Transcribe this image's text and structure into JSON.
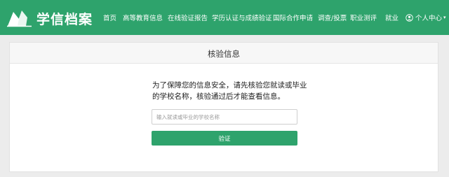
{
  "header": {
    "logo_text": "学信档案",
    "nav": [
      {
        "label": "首页"
      },
      {
        "label": "高等教育信息"
      },
      {
        "label": "在线验证报告"
      },
      {
        "label": "学历认证与成绩验证"
      },
      {
        "label": "国际合作申请"
      },
      {
        "label": "调查/投票"
      },
      {
        "label": "职业测评"
      },
      {
        "label": "就业"
      }
    ],
    "user_center": "个人中心"
  },
  "verify": {
    "title": "核验信息",
    "message": "为了保障您的信息安全，请先核验您就读或毕业的学校名称，核验通过后才能查看信息。",
    "input_value": "",
    "input_placeholder": "输入就读或毕业的学校名称",
    "button_label": "验证"
  },
  "colors": {
    "brand_green": "#2ea36c",
    "background": "#ececec"
  },
  "icons": [
    "logo-book-icon",
    "user-icon",
    "chevron-down-icon"
  ]
}
